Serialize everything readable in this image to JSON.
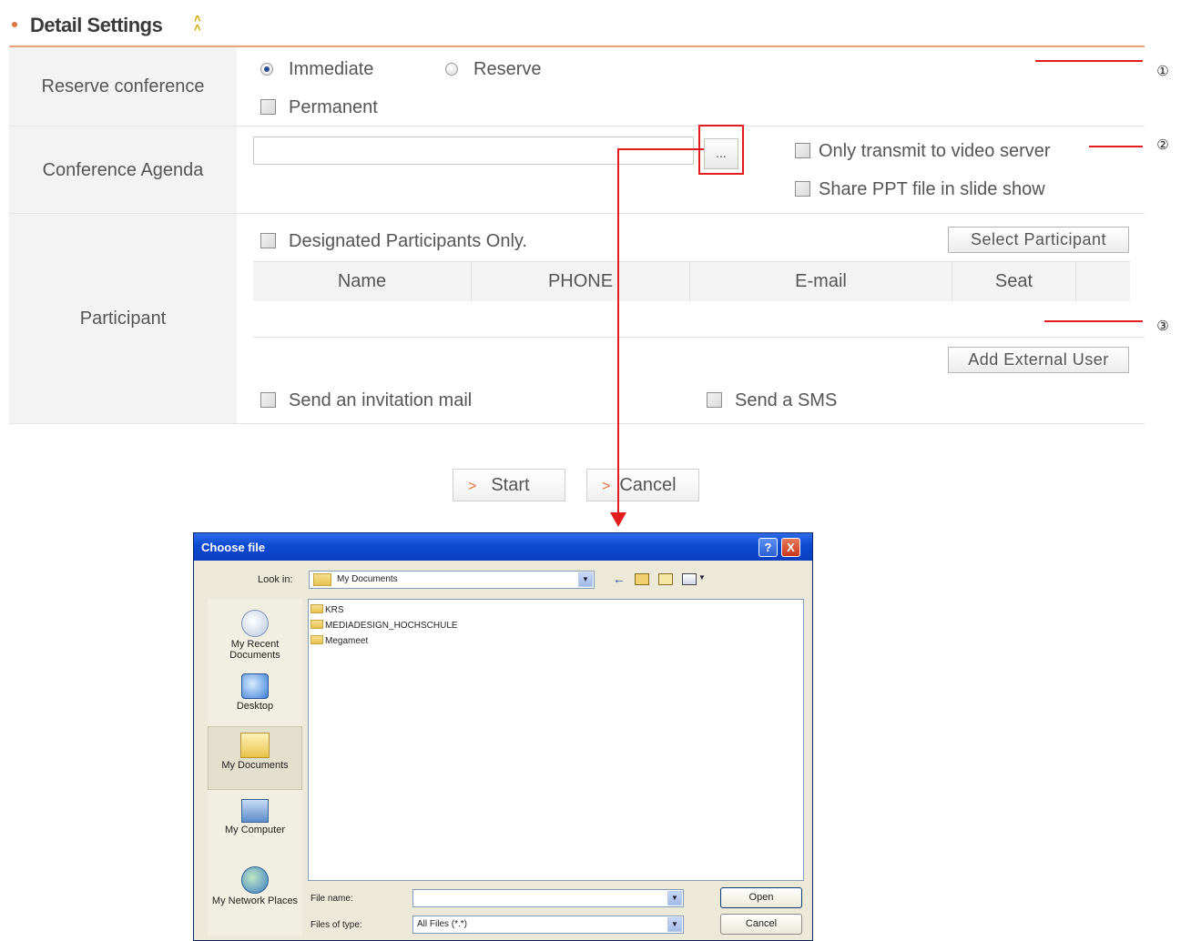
{
  "section": {
    "title": "Detail Settings"
  },
  "rows": {
    "reserve": {
      "label": "Reserve conference",
      "opt_immediate": "Immediate",
      "opt_reserve": "Reserve",
      "opt_permanent": "Permanent",
      "selected": "Immediate"
    },
    "agenda": {
      "label": "Conference Agenda",
      "input_value": "",
      "browse_label": "...",
      "opt_video_server": "Only transmit to video server",
      "opt_share_ppt": "Share PPT file in slide show"
    },
    "participant": {
      "label": "Participant",
      "opt_designated": "Designated Participants Only.",
      "select_button": "Select Participant",
      "columns": [
        "Name",
        "PHONE",
        "E-mail",
        "Seat"
      ],
      "add_external_button": "Add External User",
      "opt_invite_mail": "Send an invitation mail",
      "opt_sms": "Send a SMS"
    }
  },
  "callouts": [
    "①",
    "②",
    "③"
  ],
  "actions": {
    "start": "Start",
    "cancel": "Cancel",
    "arrow": ">"
  },
  "dialog": {
    "title": "Choose file",
    "help": "?",
    "close": "X",
    "look_in_label": "Look in:",
    "look_in_value": "My Documents",
    "places": [
      "My Recent Documents",
      "Desktop",
      "My Documents",
      "My Computer",
      "My Network Places"
    ],
    "selected_place": "My Documents",
    "folders": [
      "KRS",
      "MEDIADESIGN_HOCHSCHULE",
      "Megameet"
    ],
    "file_name_label": "File name:",
    "file_name_value": "",
    "file_type_label": "Files of type:",
    "file_type_value": "All Files (*.*)",
    "open_button": "Open",
    "cancel_button": "Cancel"
  },
  "colors": {
    "accent": "#e0743f",
    "callout": "#e31d1d",
    "xp_title": "#0b49d1"
  }
}
